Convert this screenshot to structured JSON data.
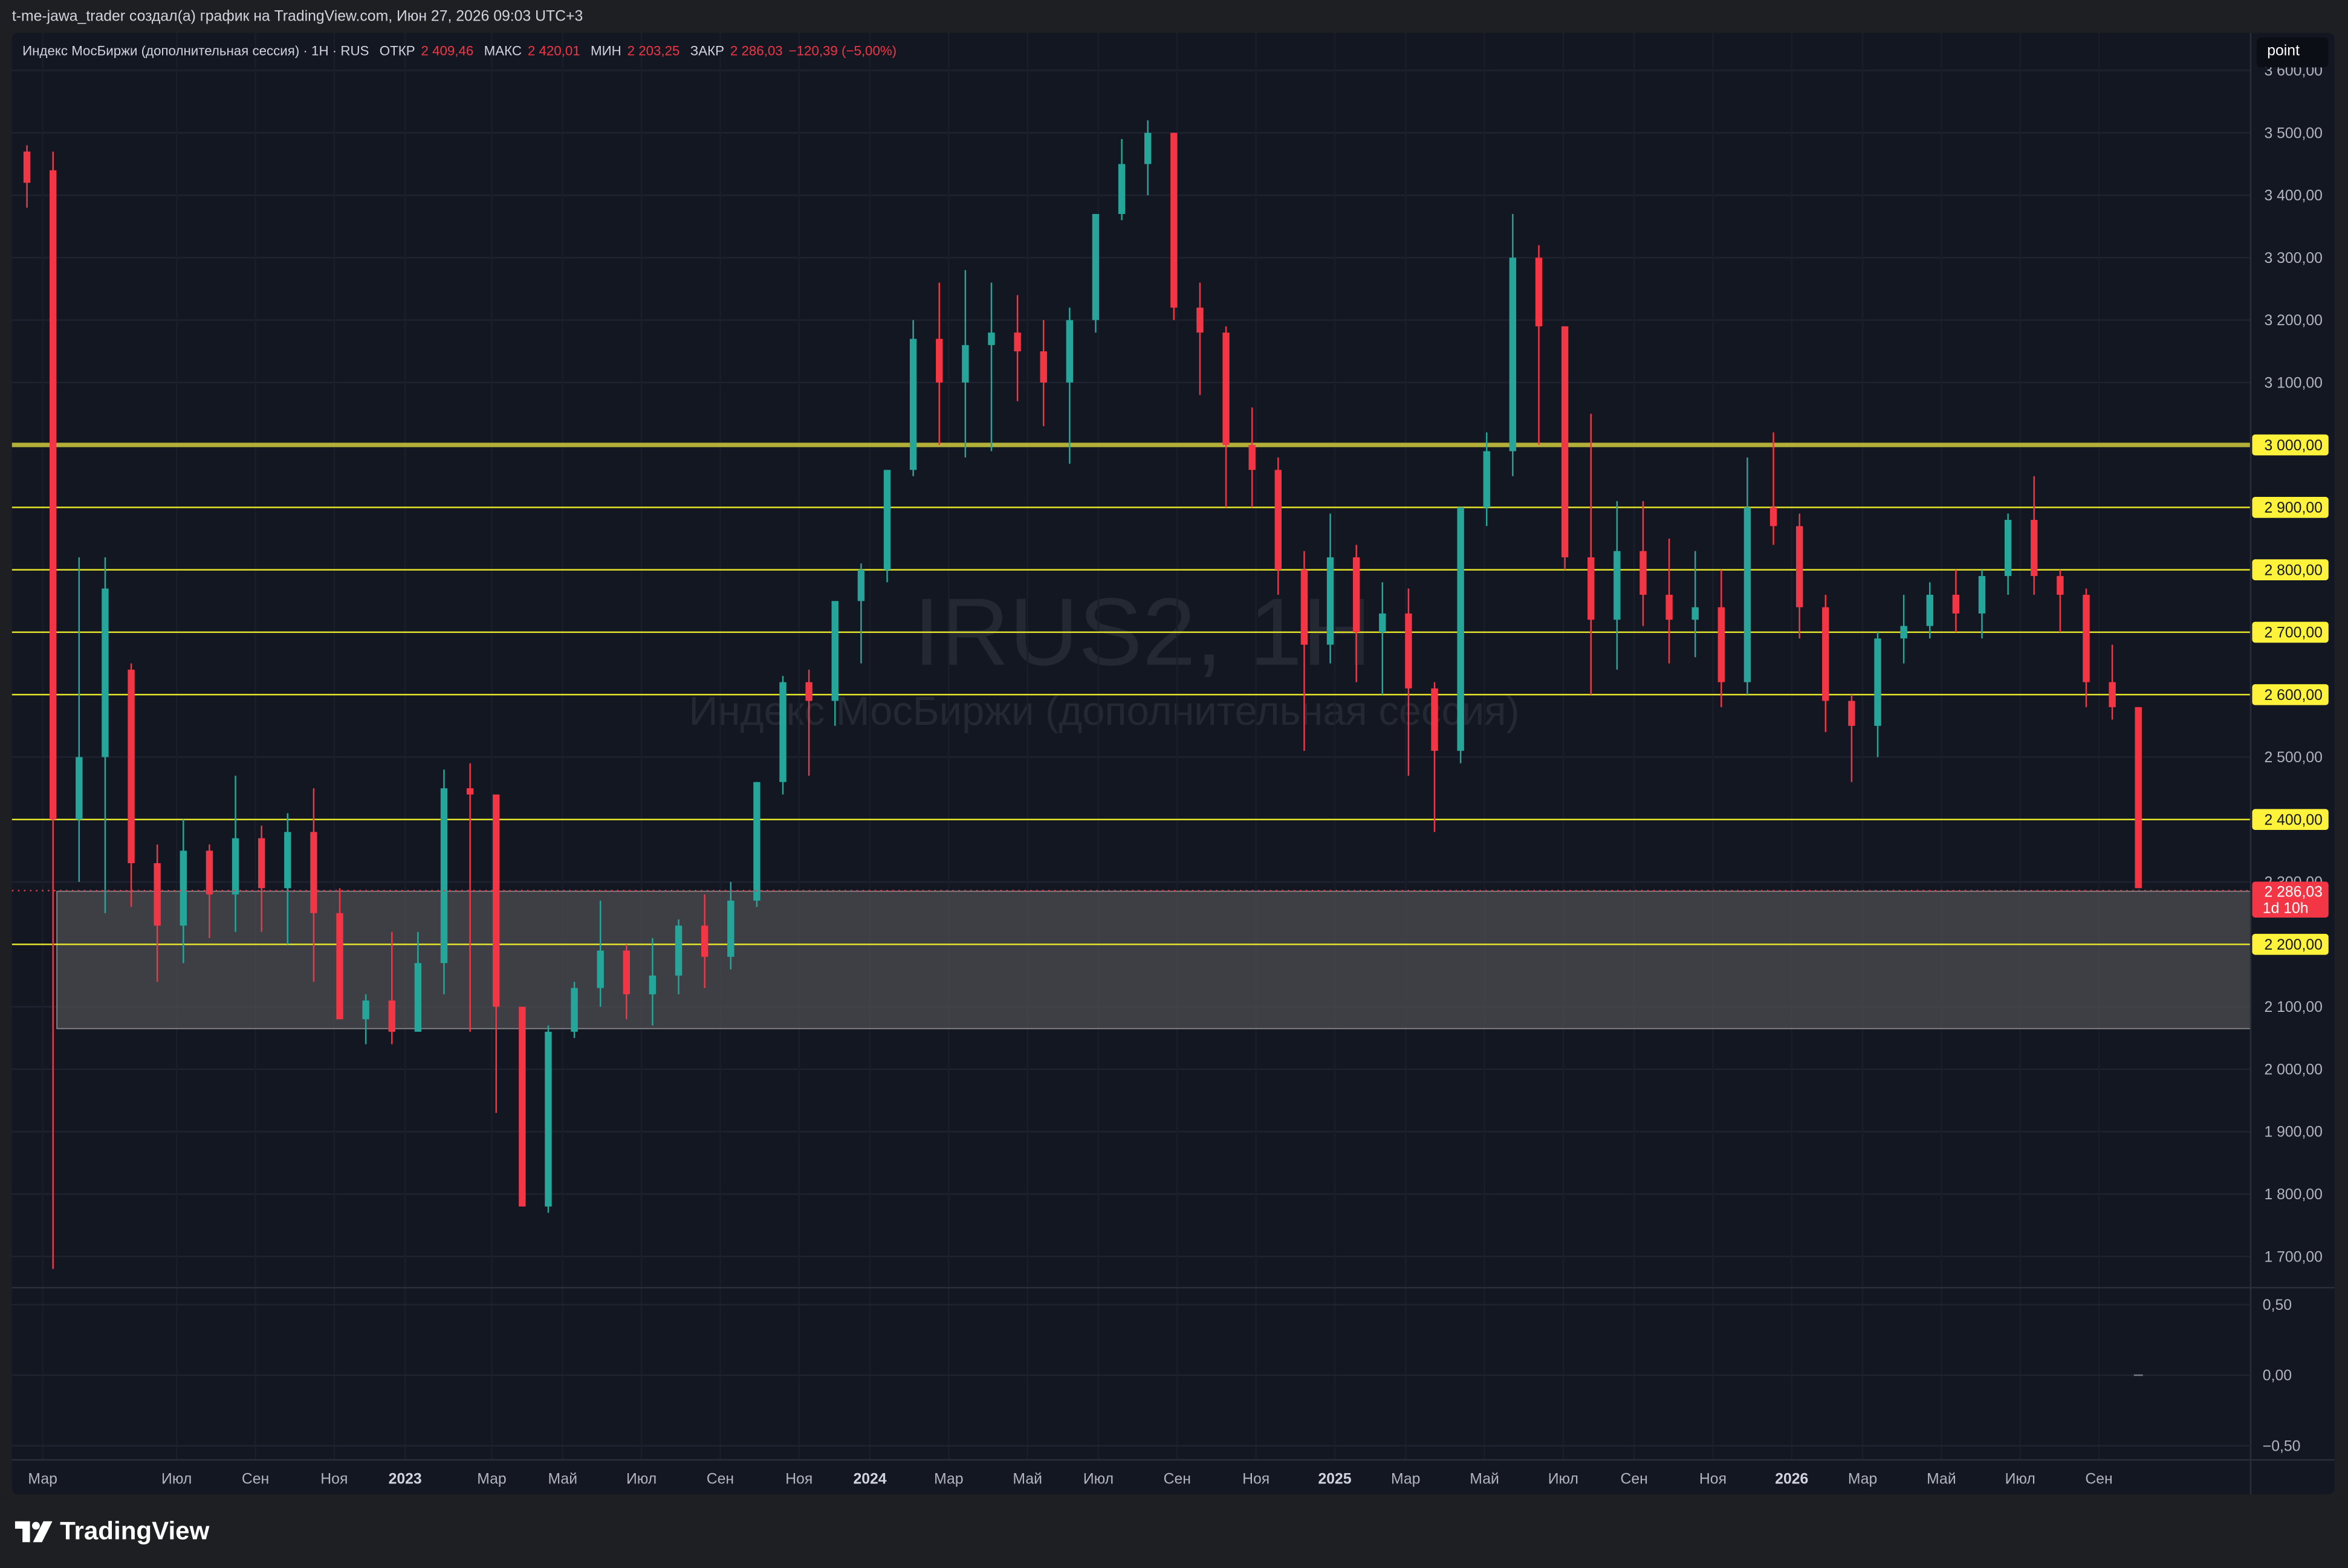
{
  "header": {
    "credit": "t-me-jawa_trader создал(а) график на TradingView.com, Июн 27, 2026 09:03 UTC+3"
  },
  "legend": {
    "symbol": "Индекс МосБиржи (дополнительная сессия) · 1H · RUS",
    "open_label": "ОТКР",
    "open_value": "2 409,46",
    "high_label": "МАКС",
    "high_value": "2 420,01",
    "low_label": "МИН",
    "low_value": "2 203,25",
    "close_label": "ЗАКР",
    "close_value": "2 286,03",
    "change": "−120,39 (−5,00%)"
  },
  "scale_button": "point",
  "watermark": {
    "ticker": "IRUS2, 1H",
    "name": "Индекс МосБиржи (дополнительная сессия)"
  },
  "footer": {
    "brand": "TradingView"
  },
  "colors": {
    "up": "#26a69a",
    "down": "#f23645",
    "level_line": "#e4e42a",
    "level_line_major": "#b3b03a",
    "zone": "#4e4e50",
    "background": "#131722"
  },
  "chart_data": {
    "type": "candlestick",
    "price_axis": {
      "ticks": [
        {
          "v": 3600,
          "label": "3 600,00"
        },
        {
          "v": 3500,
          "label": "3 500,00"
        },
        {
          "v": 3400,
          "label": "3 400,00"
        },
        {
          "v": 3300,
          "label": "3 300,00"
        },
        {
          "v": 3200,
          "label": "3 200,00"
        },
        {
          "v": 3100,
          "label": "3 100,00"
        },
        {
          "v": 2500,
          "label": "2 500,00"
        },
        {
          "v": 2300,
          "label": "2 300,00"
        },
        {
          "v": 2100,
          "label": "2 100,00"
        },
        {
          "v": 2000,
          "label": "2 000,00"
        },
        {
          "v": 1900,
          "label": "1 900,00"
        },
        {
          "v": 1800,
          "label": "1 800,00"
        },
        {
          "v": 1700,
          "label": "1 700,00"
        }
      ],
      "range": [
        1650,
        3660
      ]
    },
    "levels": [
      {
        "v": 3000,
        "label": "3 000,00",
        "major": true
      },
      {
        "v": 2900,
        "label": "2 900,00"
      },
      {
        "v": 2800,
        "label": "2 800,00"
      },
      {
        "v": 2700,
        "label": "2 700,00"
      },
      {
        "v": 2600,
        "label": "2 600,00"
      },
      {
        "v": 2400,
        "label": "2 400,00"
      },
      {
        "v": 2200,
        "label": "2 200,00"
      }
    ],
    "zone": {
      "from": 2065,
      "to": 2285
    },
    "last_price": {
      "v": 2286.03,
      "label": "2 286,03",
      "countdown": "1d 10h"
    },
    "sub_axis": {
      "ticks": [
        {
          "v": 0.5,
          "label": "0,50"
        },
        {
          "v": 0,
          "label": "0,00"
        },
        {
          "v": -0.5,
          "label": "−0,50"
        }
      ],
      "range": [
        -0.6,
        0.62
      ]
    },
    "time_labels": [
      {
        "t": 2.5,
        "label": "Мар"
      },
      {
        "t": 11,
        "label": "Июл"
      },
      {
        "t": 16,
        "label": "Сен"
      },
      {
        "t": 21,
        "label": "Ноя"
      },
      {
        "t": 25.5,
        "label": "2023"
      },
      {
        "t": 31,
        "label": "Мар"
      },
      {
        "t": 35.5,
        "label": "Май"
      },
      {
        "t": 40.5,
        "label": "Июл"
      },
      {
        "t": 45.5,
        "label": "Сен"
      },
      {
        "t": 50.5,
        "label": "Ноя"
      },
      {
        "t": 55,
        "label": "2024"
      },
      {
        "t": 60,
        "label": "Мар"
      },
      {
        "t": 65,
        "label": "Май"
      },
      {
        "t": 69.5,
        "label": "Июл"
      },
      {
        "t": 74.5,
        "label": "Сен"
      },
      {
        "t": 79.5,
        "label": "Ноя"
      },
      {
        "t": 84.5,
        "label": "2025"
      },
      {
        "t": 89,
        "label": "Мар"
      },
      {
        "t": 94,
        "label": "Май"
      },
      {
        "t": 99,
        "label": "Июл"
      },
      {
        "t": 103.5,
        "label": "Сен"
      },
      {
        "t": 108.5,
        "label": "Ноя"
      },
      {
        "t": 113.5,
        "label": "2026"
      },
      {
        "t": 118,
        "label": "Мар"
      },
      {
        "t": 123,
        "label": "Май"
      },
      {
        "t": 128,
        "label": "Июл"
      },
      {
        "t": 133,
        "label": "Сен"
      }
    ],
    "candles": [
      [
        3470,
        3480,
        3380,
        3420
      ],
      [
        3440,
        3470,
        1680,
        2400
      ],
      [
        2400,
        2820,
        2300,
        2500
      ],
      [
        2500,
        2820,
        2250,
        2770
      ],
      [
        2640,
        2650,
        2260,
        2330
      ],
      [
        2330,
        2360,
        2140,
        2230
      ],
      [
        2230,
        2400,
        2170,
        2350
      ],
      [
        2350,
        2360,
        2210,
        2280
      ],
      [
        2280,
        2470,
        2220,
        2370
      ],
      [
        2370,
        2390,
        2220,
        2290
      ],
      [
        2290,
        2410,
        2200,
        2380
      ],
      [
        2380,
        2450,
        2140,
        2250
      ],
      [
        2250,
        2290,
        2080,
        2080
      ],
      [
        2080,
        2120,
        2040,
        2110
      ],
      [
        2110,
        2220,
        2040,
        2060
      ],
      [
        2060,
        2220,
        2060,
        2170
      ],
      [
        2170,
        2480,
        2120,
        2450
      ],
      [
        2450,
        2490,
        2060,
        2440
      ],
      [
        2440,
        2440,
        1930,
        2100
      ],
      [
        2100,
        2100,
        1780,
        1780
      ],
      [
        1780,
        2070,
        1770,
        2060
      ],
      [
        2060,
        2140,
        2050,
        2130
      ],
      [
        2130,
        2270,
        2100,
        2190
      ],
      [
        2190,
        2200,
        2080,
        2120
      ],
      [
        2120,
        2210,
        2070,
        2150
      ],
      [
        2150,
        2240,
        2120,
        2230
      ],
      [
        2230,
        2280,
        2130,
        2180
      ],
      [
        2180,
        2300,
        2160,
        2270
      ],
      [
        2270,
        2460,
        2260,
        2460
      ],
      [
        2460,
        2630,
        2440,
        2620
      ],
      [
        2620,
        2640,
        2470,
        2590
      ],
      [
        2590,
        2740,
        2550,
        2750
      ],
      [
        2750,
        2810,
        2650,
        2800
      ],
      [
        2800,
        2960,
        2780,
        2960
      ],
      [
        2960,
        3200,
        2950,
        3170
      ],
      [
        3170,
        3260,
        3000,
        3100
      ],
      [
        3100,
        3280,
        2980,
        3160
      ],
      [
        3160,
        3260,
        2990,
        3180
      ],
      [
        3180,
        3240,
        3070,
        3150
      ],
      [
        3150,
        3200,
        3030,
        3100
      ],
      [
        3100,
        3220,
        2970,
        3200
      ],
      [
        3200,
        3370,
        3180,
        3370
      ],
      [
        3370,
        3490,
        3360,
        3450
      ],
      [
        3450,
        3520,
        3400,
        3500
      ],
      [
        3500,
        3500,
        3200,
        3220
      ],
      [
        3220,
        3260,
        3080,
        3180
      ],
      [
        3180,
        3190,
        2900,
        3000
      ],
      [
        3000,
        3060,
        2900,
        2960
      ],
      [
        2960,
        2980,
        2760,
        2800
      ],
      [
        2800,
        2830,
        2510,
        2680
      ],
      [
        2680,
        2890,
        2650,
        2820
      ],
      [
        2820,
        2840,
        2620,
        2700
      ],
      [
        2700,
        2780,
        2600,
        2730
      ],
      [
        2730,
        2770,
        2470,
        2610
      ],
      [
        2610,
        2620,
        2380,
        2510
      ],
      [
        2510,
        2900,
        2490,
        2900
      ],
      [
        2900,
        3020,
        2870,
        2990
      ],
      [
        2990,
        3370,
        2950,
        3300
      ],
      [
        3300,
        3320,
        3000,
        3190
      ],
      [
        3190,
        3190,
        2800,
        2820
      ],
      [
        2820,
        3050,
        2600,
        2720
      ],
      [
        2720,
        2910,
        2640,
        2830
      ],
      [
        2830,
        2910,
        2710,
        2760
      ],
      [
        2760,
        2850,
        2650,
        2720
      ],
      [
        2720,
        2830,
        2660,
        2740
      ],
      [
        2740,
        2800,
        2580,
        2620
      ],
      [
        2620,
        2980,
        2600,
        2900
      ],
      [
        2900,
        3020,
        2840,
        2870
      ],
      [
        2870,
        2890,
        2690,
        2740
      ],
      [
        2740,
        2760,
        2540,
        2590
      ],
      [
        2590,
        2600,
        2460,
        2550
      ],
      [
        2550,
        2700,
        2500,
        2690
      ],
      [
        2690,
        2760,
        2650,
        2710
      ],
      [
        2710,
        2780,
        2690,
        2760
      ],
      [
        2760,
        2800,
        2700,
        2730
      ],
      [
        2730,
        2800,
        2690,
        2790
      ],
      [
        2790,
        2890,
        2760,
        2880
      ],
      [
        2880,
        2950,
        2760,
        2790
      ],
      [
        2790,
        2800,
        2700,
        2760
      ],
      [
        2760,
        2770,
        2580,
        2620
      ],
      [
        2620,
        2680,
        2560,
        2580
      ],
      [
        2580,
        2580,
        2290,
        2290
      ]
    ]
  }
}
